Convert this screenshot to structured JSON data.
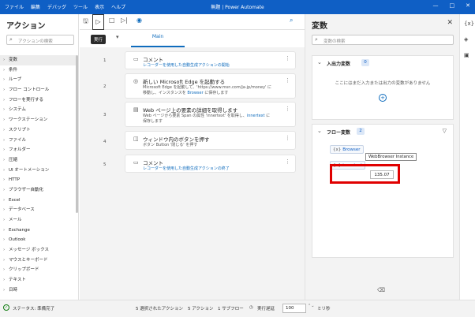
{
  "titlebar": {
    "menu": [
      "ファイル",
      "編集",
      "デバッグ",
      "ツール",
      "表示",
      "ヘルプ"
    ],
    "title": "無題 | Power Automate",
    "controls": [
      "—",
      "□",
      "✕"
    ]
  },
  "actions_panel": {
    "title": "アクション",
    "search_placeholder": "アクションの検索",
    "items": [
      "変数",
      "条件",
      "ループ",
      "フロー コントロール",
      "フローを実行する",
      "システム",
      "ワークステーション",
      "スクリプト",
      "ファイル",
      "フォルダー",
      "圧縮",
      "UI オートメーション",
      "HTTP",
      "ブラウザー自動化",
      "Excel",
      "データベース",
      "メール",
      "Exchange",
      "Outlook",
      "メッセージ ボックス",
      "マウスとキーボード",
      "クリップボード",
      "テキスト",
      "日時"
    ]
  },
  "toolbar": {
    "tooltip": "実行"
  },
  "tabs": {
    "main": "Main"
  },
  "steps": [
    {
      "num": "1",
      "icon": "comment-icon",
      "title": "コメント",
      "desc": "レコーダーを使用した自動生成アクションの開始"
    },
    {
      "num": "2",
      "icon": "globe-icon",
      "title": "新しい Microsoft Edge を起動する",
      "desc1": "Microsoft Edge を起動して、'https://www.msn.com/ja-jp/money' に",
      "desc2a": "移動し、インスタンスを ",
      "desc2v": "Browser",
      "desc2b": " に保存します"
    },
    {
      "num": "3",
      "icon": "webpage-icon",
      "title": "Web ページ上の要素の詳細を取得します",
      "desc1a": "Web ページから要素 Span の属性 'innertext' を取得し、",
      "desc1v": "innertext",
      "desc1b": " に",
      "desc2": "保存します"
    },
    {
      "num": "4",
      "icon": "button-press-icon",
      "title": "ウィンドウ内のボタンを押す",
      "desc": "ボタン Button '閉じる' を押す"
    },
    {
      "num": "5",
      "icon": "comment-icon",
      "title": "コメント",
      "desc": "レコーダーを使用した自動生成アクションの終了"
    }
  ],
  "variables_panel": {
    "title": "変数",
    "search_placeholder": "変数の検索",
    "io_section": {
      "label": "入出力変数",
      "count": "0",
      "empty": "ここにはまだ入力または出力の変数がありません"
    },
    "flow_section": {
      "label": "フロー変数",
      "count": "2",
      "vars": [
        {
          "name": "Browser",
          "tooltip": "WebBrowser Instance"
        },
        {
          "name": "innertext",
          "value": "135.07"
        }
      ]
    }
  },
  "statusbar": {
    "status": "ステータス: 準備完了",
    "selected": "5 選択されたアクション",
    "actions": "5 アクション",
    "subflows": "1 サブフロー",
    "delay_label": "実行遅延",
    "delay_value": "100",
    "ms": "ミリ秒"
  },
  "colors": {
    "titlebar": "#0f5fc5",
    "accent": "#0f6cbd",
    "highlight": "#e00000"
  }
}
